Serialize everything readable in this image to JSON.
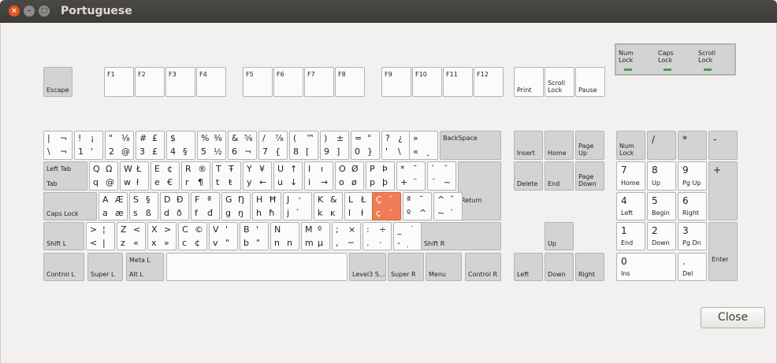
{
  "window": {
    "title": "Portuguese",
    "close_icon": "×",
    "min_icon": "–",
    "max_icon": "□"
  },
  "close_button": {
    "label": "Close"
  },
  "leds": {
    "num": "Num\nLock",
    "caps": "Caps\nLock",
    "scroll": "Scroll\nLock"
  },
  "keys": {
    "esc": "Escape",
    "f1": "F1",
    "f2": "F2",
    "f3": "F3",
    "f4": "F4",
    "f5": "F5",
    "f6": "F6",
    "f7": "F7",
    "f8": "F8",
    "f9": "F9",
    "f10": "F10",
    "f11": "F11",
    "f12": "F12",
    "print": "Print",
    "scroll": "Scroll\nLock",
    "pause": "Pause",
    "backspace": "BackSpace",
    "lefttab": "Left Tab",
    "tab": "Tab",
    "return": "Return",
    "caps": "Caps Lock",
    "shiftl": "Shift L",
    "shiftr": "Shift R",
    "ctrll": "Control L",
    "superl": "Super L",
    "metal": "Meta L",
    "altl": "Alt L",
    "level3": "Level3 S...",
    "superr": "Super R",
    "menu": "Menu",
    "ctrlr": "Control R",
    "insert": "Insert",
    "home": "Home",
    "pageup": "Page\nUp",
    "delete": "Delete",
    "end": "End",
    "pagedown": "Page\nDown",
    "up": "Up",
    "left": "Left",
    "down": "Down",
    "right": "Right",
    "numlock": "Num\nLock",
    "kpdiv": "/",
    "kpmul": "*",
    "kpsub": "-",
    "kpadd": "+",
    "kpenter": "Enter",
    "kp7": "7",
    "kp7s": "Home",
    "kp8": "8",
    "kp8s": "Up",
    "kp9": "9",
    "kp9s": "Pg Up",
    "kp4": "4",
    "kp4s": "Left",
    "kp5": "5",
    "kp5s": "Begin",
    "kp6": "6",
    "kp6s": "Right",
    "kp1": "1",
    "kp1s": "End",
    "kp2": "2",
    "kp2s": "Down",
    "kp3": "3",
    "kp3s": "Pg Dn",
    "kp0": "0",
    "kp0s": "Ins",
    "kpdot": ".",
    "kpdots": "Del"
  },
  "glyphs": {
    "r1": [
      [
        "|",
        "¬",
        "\\",
        "¬"
      ],
      [
        "!",
        "¡",
        "1",
        "'"
      ],
      [
        "\"",
        "⅛",
        "2",
        "@"
      ],
      [
        "#",
        "£",
        "3",
        "£"
      ],
      [
        "$",
        "",
        "4",
        "§"
      ],
      [
        "%",
        "⅜",
        "5",
        "½"
      ],
      [
        "&",
        "⅝",
        "6",
        "¬"
      ],
      [
        "/",
        "⅞",
        "7",
        "{"
      ],
      [
        "(",
        "™",
        "8",
        "["
      ],
      [
        ")",
        "±",
        "9",
        "]"
      ],
      [
        "=",
        "°",
        "0",
        "}"
      ],
      [
        "?",
        "¿",
        "'",
        "\\"
      ],
      [
        "»",
        "",
        "«",
        "¸"
      ]
    ],
    "r2": [
      [
        "Q",
        "Ω",
        "q",
        "@"
      ],
      [
        "W",
        "Ł",
        "w",
        "ł"
      ],
      [
        "E",
        "¢",
        "e",
        "€"
      ],
      [
        "R",
        "®",
        "r",
        "¶"
      ],
      [
        "T",
        "Ŧ",
        "t",
        "ŧ"
      ],
      [
        "Y",
        "¥",
        "y",
        "←"
      ],
      [
        "U",
        "↑",
        "u",
        "↓"
      ],
      [
        "I",
        "ı",
        "i",
        "→"
      ],
      [
        "O",
        "Ø",
        "o",
        "ø"
      ],
      [
        "P",
        "Þ",
        "p",
        "þ"
      ],
      [
        "*",
        "¯",
        "+",
        "¨"
      ],
      [
        "`",
        "˘",
        "´",
        "~"
      ]
    ],
    "r3": [
      [
        "A",
        "Æ",
        "a",
        "æ"
      ],
      [
        "S",
        "§",
        "s",
        "ß"
      ],
      [
        "D",
        "Ð",
        "d",
        "ð"
      ],
      [
        "F",
        "ª",
        "f",
        "đ"
      ],
      [
        "G",
        "Ŋ",
        "g",
        "ŋ"
      ],
      [
        "H",
        "Ħ",
        "h",
        "ħ"
      ],
      [
        "J",
        "̛",
        "j",
        "̉"
      ],
      [
        "K",
        "&",
        "k",
        "ĸ"
      ],
      [
        "L",
        "Ł",
        "l",
        "ł"
      ],
      [
        "Ç",
        "˝",
        "ç",
        "´"
      ],
      [
        "ª",
        "˘",
        "º",
        "^"
      ],
      [
        "^",
        "ˇ",
        "~",
        "`"
      ]
    ],
    "r4": [
      [
        ">",
        "¦",
        "<",
        "|"
      ],
      [
        "Z",
        "<",
        "z",
        "«"
      ],
      [
        "X",
        ">",
        "x",
        "»"
      ],
      [
        "C",
        "©",
        "c",
        "¢"
      ],
      [
        "V",
        "'",
        "v",
        "\""
      ],
      [
        "B",
        "'",
        "b",
        "\""
      ],
      [
        "N",
        "",
        "n",
        "n"
      ],
      [
        "M",
        "º",
        "m",
        "µ"
      ],
      [
        ";",
        "×",
        ",",
        "─"
      ],
      [
        ":",
        "÷",
        ".",
        "·"
      ],
      [
        "_",
        "˙",
        "-",
        "̣"
      ]
    ]
  }
}
